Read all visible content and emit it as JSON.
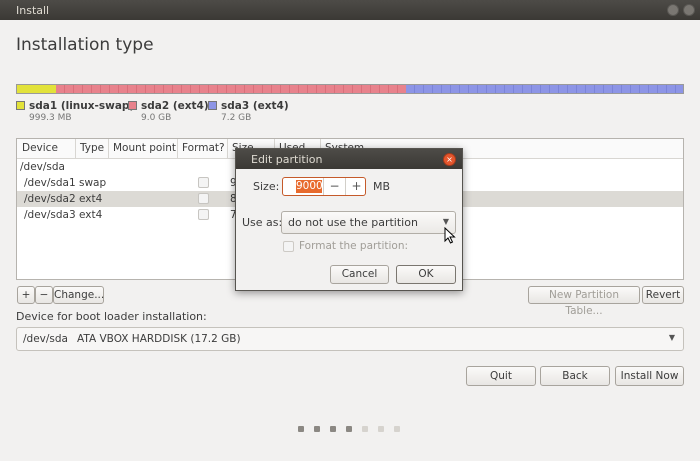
{
  "window": {
    "title": "Install"
  },
  "page": {
    "title": "Installation type"
  },
  "partitions": [
    {
      "name": "sda1 (linux-swap)",
      "size": "999.3 MB",
      "color": "#e2e23a"
    },
    {
      "name": "sda2 (ext4)",
      "size": "9.0 GB",
      "color": "#e8828c"
    },
    {
      "name": "sda3 (ext4)",
      "size": "7.2 GB",
      "color": "#8d95e6"
    }
  ],
  "table": {
    "headers": [
      "Device",
      "Type",
      "Mount point",
      "Format?",
      "Size",
      "Used",
      "System"
    ],
    "rows": [
      {
        "device": "/dev/sda",
        "type": "",
        "size": ""
      },
      {
        "device": "/dev/sda1",
        "type": "swap",
        "size": "9"
      },
      {
        "device": "/dev/sda2",
        "type": "ext4",
        "size": "8"
      },
      {
        "device": "/dev/sda3",
        "type": "ext4",
        "size": "7"
      }
    ]
  },
  "toolbar": {
    "add_label": "+",
    "remove_label": "−",
    "change_label": "Change...",
    "new_table_label": "New Partition Table...",
    "revert_label": "Revert"
  },
  "boot": {
    "label": "Device for boot loader installation:",
    "device": "/dev/sda",
    "description": "ATA VBOX HARDDISK (17.2 GB)"
  },
  "nav": {
    "quit": "Quit",
    "back": "Back",
    "install": "Install Now"
  },
  "dialog": {
    "title": "Edit partition",
    "size_label": "Size:",
    "size_value": "9000",
    "size_unit": "MB",
    "minus": "−",
    "plus": "+",
    "useas_label": "Use as:",
    "useas_value": "do not use the partition",
    "format_label": "Format the partition:",
    "cancel": "Cancel",
    "ok": "OK",
    "close": "×"
  },
  "steps": {
    "total": 7,
    "completed": 4
  }
}
